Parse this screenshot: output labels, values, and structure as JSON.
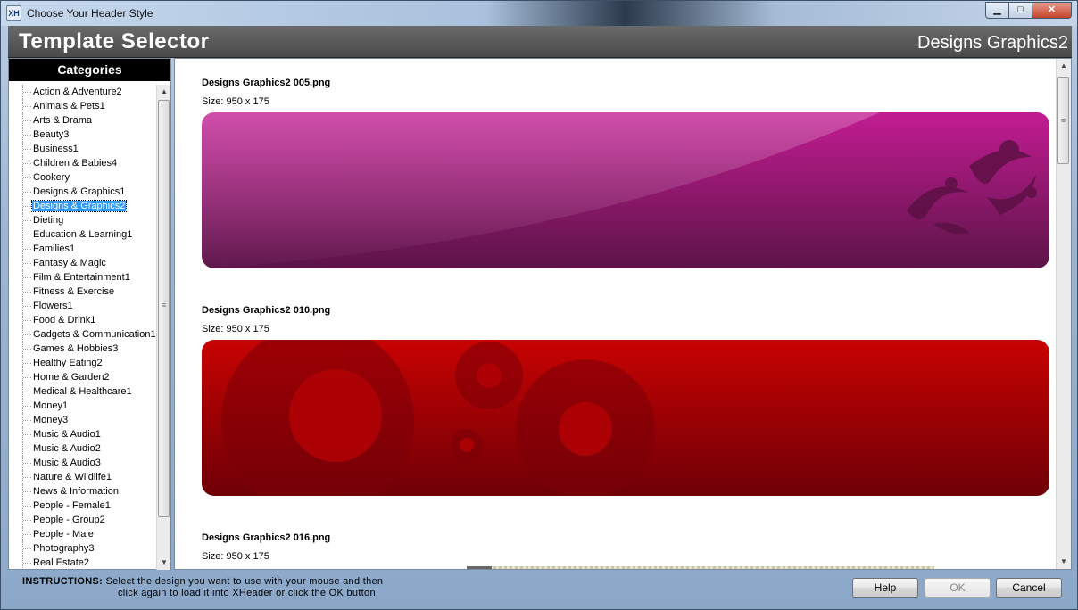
{
  "window": {
    "app_icon_text": "XH",
    "title": "Choose Your Header Style",
    "controls": {
      "minimize": "▁",
      "maximize": "□",
      "close": "✕"
    }
  },
  "header": {
    "title": "Template Selector",
    "current_category": "Designs Graphics2"
  },
  "categories": {
    "heading": "Categories",
    "selected_index": 8,
    "items": [
      "Action & Adventure2",
      "Animals & Pets1",
      "Arts & Drama",
      "Beauty3",
      "Business1",
      "Children & Babies4",
      "Cookery",
      "Designs & Graphics1",
      "Designs & Graphics2",
      "Dieting",
      "Education & Learning1",
      "Families1",
      "Fantasy & Magic",
      "Film & Entertainment1",
      "Fitness & Exercise",
      "Flowers1",
      "Food & Drink1",
      "Gadgets & Communication1",
      "Games & Hobbies3",
      "Healthy Eating2",
      "Home & Garden2",
      "Medical & Healthcare1",
      "Money1",
      "Money3",
      "Music & Audio1",
      "Music & Audio2",
      "Music & Audio3",
      "Nature & Wildlife1",
      "News & Information",
      "People - Female1",
      "People - Group2",
      "People - Male",
      "Photography3",
      "Real Estate2"
    ]
  },
  "designs": [
    {
      "name": "Designs Graphics2 005.png",
      "size": "Size: 950 x 175",
      "colors": [
        "#c0198f",
        "#5a1246"
      ]
    },
    {
      "name": "Designs Graphics2 010.png",
      "size": "Size: 950 x 175",
      "colors": [
        "#c40000",
        "#6a0004"
      ]
    },
    {
      "name": "Designs Graphics2 016.png",
      "size": "Size: 950 x 175"
    }
  ],
  "footer": {
    "instructions_label": "INSTRUCTIONS:",
    "instructions_line1": "Select the design you want to use with your mouse and then",
    "instructions_line2": "click again to load it into XHeader or click the OK button.",
    "help_label": "Help",
    "ok_label": "OK",
    "cancel_label": "Cancel"
  }
}
